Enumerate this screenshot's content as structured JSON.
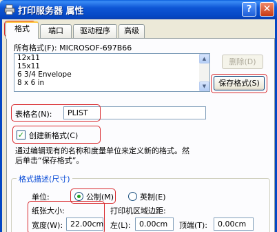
{
  "title": "打印服务器 属性",
  "window_buttons": {
    "help": "?",
    "close": "✕"
  },
  "tabs": [
    "格式",
    "端口",
    "驱动程序",
    "高级"
  ],
  "formats_label": "所有格式(F): MICROSOF-697B66",
  "formats_list": [
    "12x11",
    "15x11",
    "6 3/4 Envelope",
    "8 x 6 in"
  ],
  "delete_button": "删除(D)",
  "save_button": "保存格式(S)",
  "form_name_label": "表格名(N):",
  "form_name_value": "PLIST",
  "create_new_label": "创建新格式(C)",
  "create_new_checked": true,
  "description_line1": "通过编辑现有的名称和度量单位来定义新的格式。然",
  "description_line2": "后单击“保存格式”。",
  "group_title": "格式描述(尺寸)",
  "unit_label": "单位:",
  "unit_metric": "公制(M)",
  "unit_english": "英制(E)",
  "paper_size_label": "纸张大小:",
  "margin_label": "打印机区域边距:",
  "width_label": "宽度(W):",
  "width_value": "22.00cm",
  "left_label": "左(L):",
  "left_value": "0.00cm",
  "top_label": "顶端(T):",
  "top_value": "0.00cm"
}
